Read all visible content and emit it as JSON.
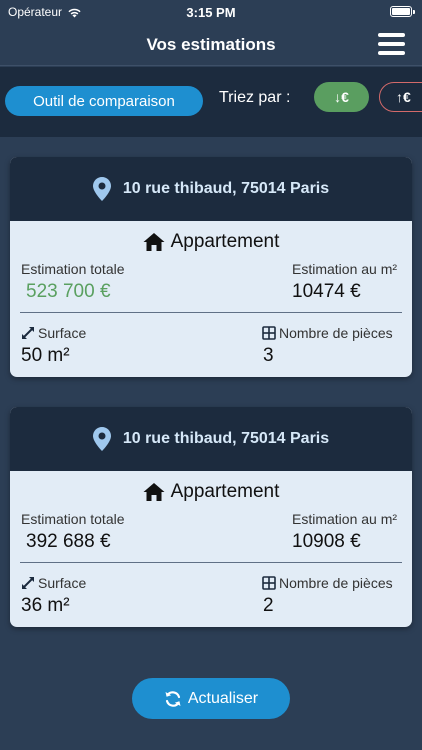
{
  "status_bar": {
    "carrier": "Opérateur",
    "time": "3:15 PM"
  },
  "nav": {
    "title": "Vos estimations"
  },
  "toolbar": {
    "compare_label": "Outil de comparaison",
    "sort_label": "Triez par :",
    "sort_desc_label": "↓€",
    "sort_asc_label": "↑€",
    "sort_desc_color": "#5a9e60",
    "sort_asc_border_color": "#d46a6a"
  },
  "cards": [
    {
      "address": "10 rue thibaud, 75014 Paris",
      "type": "Appartement",
      "total_label": "Estimation totale",
      "total_value": "523 700 €",
      "per_m2_label": "Estimation au m²",
      "per_m2_value": "10474 €",
      "surface_label": "Surface",
      "surface_value": "50 m²",
      "rooms_label": "Nombre de pièces",
      "rooms_value": "3",
      "total_color": "#5aa060"
    },
    {
      "address": "10 rue thibaud, 75014 Paris",
      "type": "Appartement",
      "total_label": "Estimation totale",
      "total_value": "392 688 €",
      "per_m2_label": "Estimation au m²",
      "per_m2_value": "10908 €",
      "surface_label": "Surface",
      "surface_value": "36 m²",
      "rooms_label": "Nombre de pièces",
      "rooms_value": "2",
      "total_color": "#111111"
    }
  ],
  "refresh": {
    "label": "Actualiser"
  },
  "icons": {
    "wifi": "wifi-icon",
    "battery": "battery-icon",
    "menu": "hamburger-menu-icon",
    "pin": "location-pin-icon",
    "home": "home-icon",
    "expand": "expand-arrows-icon",
    "grid": "grid-icon",
    "refresh": "refresh-icon"
  }
}
